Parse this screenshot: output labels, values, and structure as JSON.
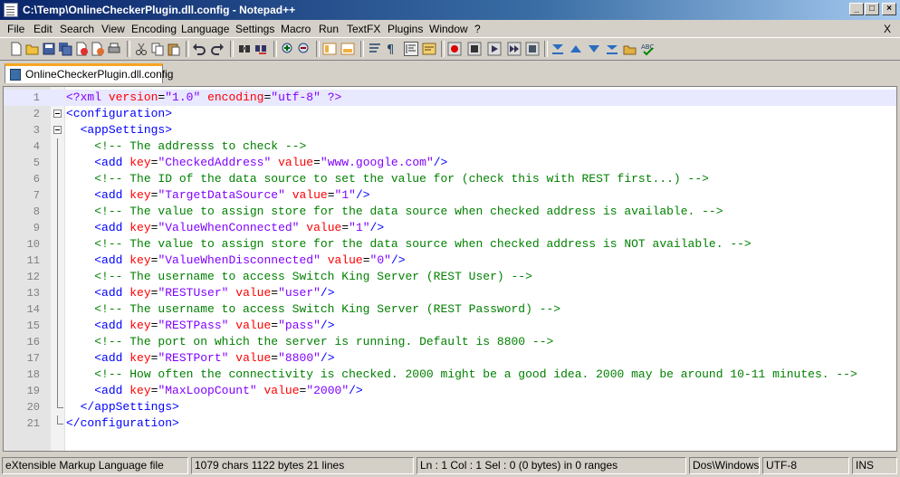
{
  "window": {
    "title": "C:\\Temp\\OnlineCheckerPlugin.dll.config - Notepad++",
    "minimize": "_",
    "maximize": "□",
    "close": "×"
  },
  "menu": {
    "items": [
      "File",
      "Edit",
      "Search",
      "View",
      "Encoding",
      "Language",
      "Settings",
      "Macro",
      "Run",
      "TextFX",
      "Plugins",
      "Window",
      "?"
    ],
    "close_doc": "X"
  },
  "toolbar": {
    "icons": [
      "new-icon",
      "open-icon",
      "save-icon",
      "save-all-icon",
      "close-icon",
      "close-all-icon",
      "print-icon",
      "cut-icon",
      "copy-icon",
      "paste-icon",
      "undo-icon",
      "redo-icon",
      "find-icon",
      "replace-icon",
      "zoom-in-icon",
      "zoom-out-icon",
      "sync-vertical-icon",
      "sync-horizontal-icon",
      "word-wrap-icon",
      "show-all-chars-icon",
      "indent-guide-icon",
      "user-lang-icon",
      "record-macro-icon",
      "stop-record-icon",
      "play-macro-icon",
      "run-multiple-icon",
      "save-macro-icon",
      "trim-icon",
      "up-icon",
      "down-icon",
      "block-icon",
      "folder-icon",
      "spellcheck-icon"
    ]
  },
  "tab": {
    "label": "OnlineCheckerPlugin.dll.config"
  },
  "editor": {
    "lines": [
      {
        "n": "1",
        "tokens": [
          [
            "pi",
            "<?xml "
          ],
          [
            "attr",
            "version"
          ],
          [
            "txt",
            "="
          ],
          [
            "val",
            "\"1.0\""
          ],
          [
            "txt",
            " "
          ],
          [
            "attr",
            "encoding"
          ],
          [
            "txt",
            "="
          ],
          [
            "val",
            "\"utf-8\""
          ],
          [
            "pi",
            " ?>"
          ]
        ]
      },
      {
        "n": "2",
        "tokens": [
          [
            "tag",
            "<configuration>"
          ]
        ]
      },
      {
        "n": "3",
        "tokens": [
          [
            "txt",
            "  "
          ],
          [
            "tag",
            "<appSettings>"
          ]
        ]
      },
      {
        "n": "4",
        "tokens": [
          [
            "txt",
            "    "
          ],
          [
            "com",
            "<!-- The addresss to check -->"
          ]
        ]
      },
      {
        "n": "5",
        "tokens": [
          [
            "txt",
            "    "
          ],
          [
            "tag",
            "<add "
          ],
          [
            "attr",
            "key"
          ],
          [
            "txt",
            "="
          ],
          [
            "val",
            "\"CheckedAddress\""
          ],
          [
            "txt",
            " "
          ],
          [
            "attr",
            "value"
          ],
          [
            "txt",
            "="
          ],
          [
            "val",
            "\"www.google.com\""
          ],
          [
            "tag",
            "/>"
          ]
        ]
      },
      {
        "n": "6",
        "tokens": [
          [
            "txt",
            "    "
          ],
          [
            "com",
            "<!-- The ID of the data source to set the value for (check this with REST first...) -->"
          ]
        ]
      },
      {
        "n": "7",
        "tokens": [
          [
            "txt",
            "    "
          ],
          [
            "tag",
            "<add "
          ],
          [
            "attr",
            "key"
          ],
          [
            "txt",
            "="
          ],
          [
            "val",
            "\"TargetDataSource\""
          ],
          [
            "txt",
            " "
          ],
          [
            "attr",
            "value"
          ],
          [
            "txt",
            "="
          ],
          [
            "val",
            "\"1\""
          ],
          [
            "tag",
            "/>"
          ]
        ]
      },
      {
        "n": "8",
        "tokens": [
          [
            "txt",
            "    "
          ],
          [
            "com",
            "<!-- The value to assign store for the data source when checked address is available. -->"
          ]
        ]
      },
      {
        "n": "9",
        "tokens": [
          [
            "txt",
            "    "
          ],
          [
            "tag",
            "<add "
          ],
          [
            "attr",
            "key"
          ],
          [
            "txt",
            "="
          ],
          [
            "val",
            "\"ValueWhenConnected\""
          ],
          [
            "txt",
            " "
          ],
          [
            "attr",
            "value"
          ],
          [
            "txt",
            "="
          ],
          [
            "val",
            "\"1\""
          ],
          [
            "tag",
            "/>"
          ]
        ]
      },
      {
        "n": "10",
        "tokens": [
          [
            "txt",
            "    "
          ],
          [
            "com",
            "<!-- The value to assign store for the data source when checked address is NOT available. -->"
          ]
        ]
      },
      {
        "n": "11",
        "tokens": [
          [
            "txt",
            "    "
          ],
          [
            "tag",
            "<add "
          ],
          [
            "attr",
            "key"
          ],
          [
            "txt",
            "="
          ],
          [
            "val",
            "\"ValueWhenDisconnected\""
          ],
          [
            "txt",
            " "
          ],
          [
            "attr",
            "value"
          ],
          [
            "txt",
            "="
          ],
          [
            "val",
            "\"0\""
          ],
          [
            "tag",
            "/>"
          ]
        ]
      },
      {
        "n": "12",
        "tokens": [
          [
            "txt",
            "    "
          ],
          [
            "com",
            "<!-- The username to access Switch King Server (REST User) -->"
          ]
        ]
      },
      {
        "n": "13",
        "tokens": [
          [
            "txt",
            "    "
          ],
          [
            "tag",
            "<add "
          ],
          [
            "attr",
            "key"
          ],
          [
            "txt",
            "="
          ],
          [
            "val",
            "\"RESTUser\""
          ],
          [
            "txt",
            " "
          ],
          [
            "attr",
            "value"
          ],
          [
            "txt",
            "="
          ],
          [
            "val",
            "\"user\""
          ],
          [
            "tag",
            "/>"
          ]
        ]
      },
      {
        "n": "14",
        "tokens": [
          [
            "txt",
            "    "
          ],
          [
            "com",
            "<!-- The username to access Switch King Server (REST Password) -->"
          ]
        ]
      },
      {
        "n": "15",
        "tokens": [
          [
            "txt",
            "    "
          ],
          [
            "tag",
            "<add "
          ],
          [
            "attr",
            "key"
          ],
          [
            "txt",
            "="
          ],
          [
            "val",
            "\"RESTPass\""
          ],
          [
            "txt",
            " "
          ],
          [
            "attr",
            "value"
          ],
          [
            "txt",
            "="
          ],
          [
            "val",
            "\"pass\""
          ],
          [
            "tag",
            "/>"
          ]
        ]
      },
      {
        "n": "16",
        "tokens": [
          [
            "txt",
            "    "
          ],
          [
            "com",
            "<!-- The port on which the server is running. Default is 8800 -->"
          ]
        ]
      },
      {
        "n": "17",
        "tokens": [
          [
            "txt",
            "    "
          ],
          [
            "tag",
            "<add "
          ],
          [
            "attr",
            "key"
          ],
          [
            "txt",
            "="
          ],
          [
            "val",
            "\"RESTPort\""
          ],
          [
            "txt",
            " "
          ],
          [
            "attr",
            "value"
          ],
          [
            "txt",
            "="
          ],
          [
            "val",
            "\"8800\""
          ],
          [
            "tag",
            "/>"
          ]
        ]
      },
      {
        "n": "18",
        "tokens": [
          [
            "txt",
            "    "
          ],
          [
            "com",
            "<!-- How often the connectivity is checked. 2000 might be a good idea. 2000 may be around 10-11 minutes. -->"
          ]
        ]
      },
      {
        "n": "19",
        "tokens": [
          [
            "txt",
            "    "
          ],
          [
            "tag",
            "<add "
          ],
          [
            "attr",
            "key"
          ],
          [
            "txt",
            "="
          ],
          [
            "val",
            "\"MaxLoopCount\""
          ],
          [
            "txt",
            " "
          ],
          [
            "attr",
            "value"
          ],
          [
            "txt",
            "="
          ],
          [
            "val",
            "\"2000\""
          ],
          [
            "tag",
            "/>"
          ]
        ]
      },
      {
        "n": "20",
        "tokens": [
          [
            "txt",
            "  "
          ],
          [
            "tag",
            "</appSettings>"
          ]
        ]
      },
      {
        "n": "21",
        "tokens": [
          [
            "tag",
            "</configuration>"
          ]
        ]
      }
    ]
  },
  "status": {
    "filetype": "eXtensible Markup Language file",
    "stats": "1079 chars   1122 bytes   21 lines",
    "position": "Ln : 1    Col : 1    Sel : 0 (0 bytes) in 0 ranges",
    "eol": "Dos\\Windows",
    "encoding": "UTF-8",
    "mode": "INS"
  }
}
